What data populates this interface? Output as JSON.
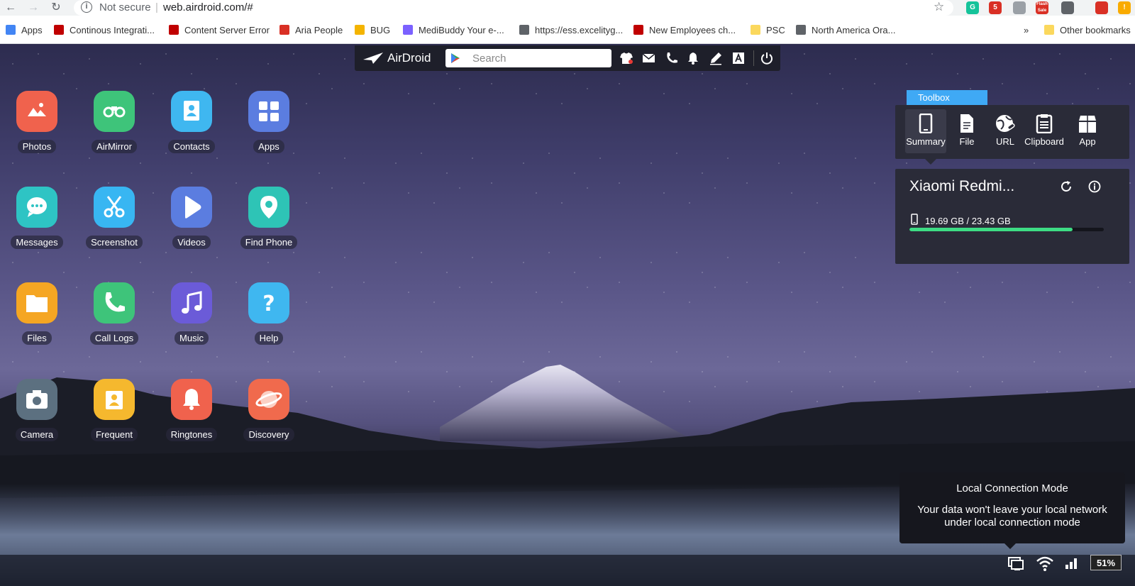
{
  "browser": {
    "security_label": "Not secure",
    "separator": "|",
    "url": "web.airdroid.com/#",
    "extensions": [
      {
        "name": "grammarly",
        "label": "G",
        "color": "#15c39a"
      },
      {
        "name": "ext-badge",
        "label": "5",
        "color": "#d93025"
      },
      {
        "name": "cart",
        "label": "",
        "color": "#9aa0a6"
      },
      {
        "name": "flash-sale",
        "label": "Flash Sale",
        "color": "#d93025"
      },
      {
        "name": "calendar",
        "label": "",
        "color": "#5f6368"
      },
      {
        "name": "offer",
        "label": "",
        "color": "#d93025"
      },
      {
        "name": "alert",
        "label": "!",
        "color": "#f9ab00"
      }
    ]
  },
  "bookmarks": {
    "items": [
      {
        "label": "Apps",
        "color": "#4285f4"
      },
      {
        "label": "Continous Integrati...",
        "color": "#c00000"
      },
      {
        "label": "Content Server Error",
        "color": "#c00000"
      },
      {
        "label": "Aria People",
        "color": "#d93025"
      },
      {
        "label": "BUG",
        "color": "#f4b400"
      },
      {
        "label": "MediBuddy Your e-...",
        "color": "#7b61ff"
      },
      {
        "label": "https://ess.excelityg...",
        "color": "#5f6368"
      },
      {
        "label": "New Employees ch...",
        "color": "#c00000"
      },
      {
        "label": "PSC",
        "color": "#fbd85d"
      },
      {
        "label": "North America Ora...",
        "color": "#5f6368"
      }
    ],
    "overflow": "»",
    "other": "Other bookmarks"
  },
  "toolbar": {
    "logo": "AirDroid",
    "search_placeholder": "Search"
  },
  "apps": [
    {
      "label": "Photos",
      "color": "#f0624d"
    },
    {
      "label": "AirMirror",
      "color": "#3ec47a"
    },
    {
      "label": "Contacts",
      "color": "#3fb7f0"
    },
    {
      "label": "Apps",
      "color": "#5b7de0"
    },
    {
      "label": "Messages",
      "color": "#2ec4c4"
    },
    {
      "label": "Screenshot",
      "color": "#38b6f2"
    },
    {
      "label": "Videos",
      "color": "#5b7de0"
    },
    {
      "label": "Find Phone",
      "color": "#2ec4b6"
    },
    {
      "label": "Files",
      "color": "#f5a623"
    },
    {
      "label": "Call Logs",
      "color": "#3ec47a"
    },
    {
      "label": "Music",
      "color": "#6b5bd8"
    },
    {
      "label": "Help",
      "color": "#3fb7f0"
    },
    {
      "label": "Camera",
      "color": "#5c7080"
    },
    {
      "label": "Frequent",
      "color": "#f5b82e"
    },
    {
      "label": "Ringtones",
      "color": "#f0624d"
    },
    {
      "label": "Discovery",
      "color": "#f06a4d"
    }
  ],
  "toolbox": {
    "tab": "Toolbox",
    "tools": [
      "Summary",
      "File",
      "URL",
      "Clipboard",
      "App"
    ]
  },
  "device": {
    "name": "Xiaomi Redmi...",
    "storage_text": "19.69 GB / 23.43 GB",
    "storage_used_fraction": 0.84
  },
  "notice": {
    "title": "Local Connection Mode",
    "body": "Your data won't leave your local network under local connection mode"
  },
  "status": {
    "battery": "51%"
  }
}
